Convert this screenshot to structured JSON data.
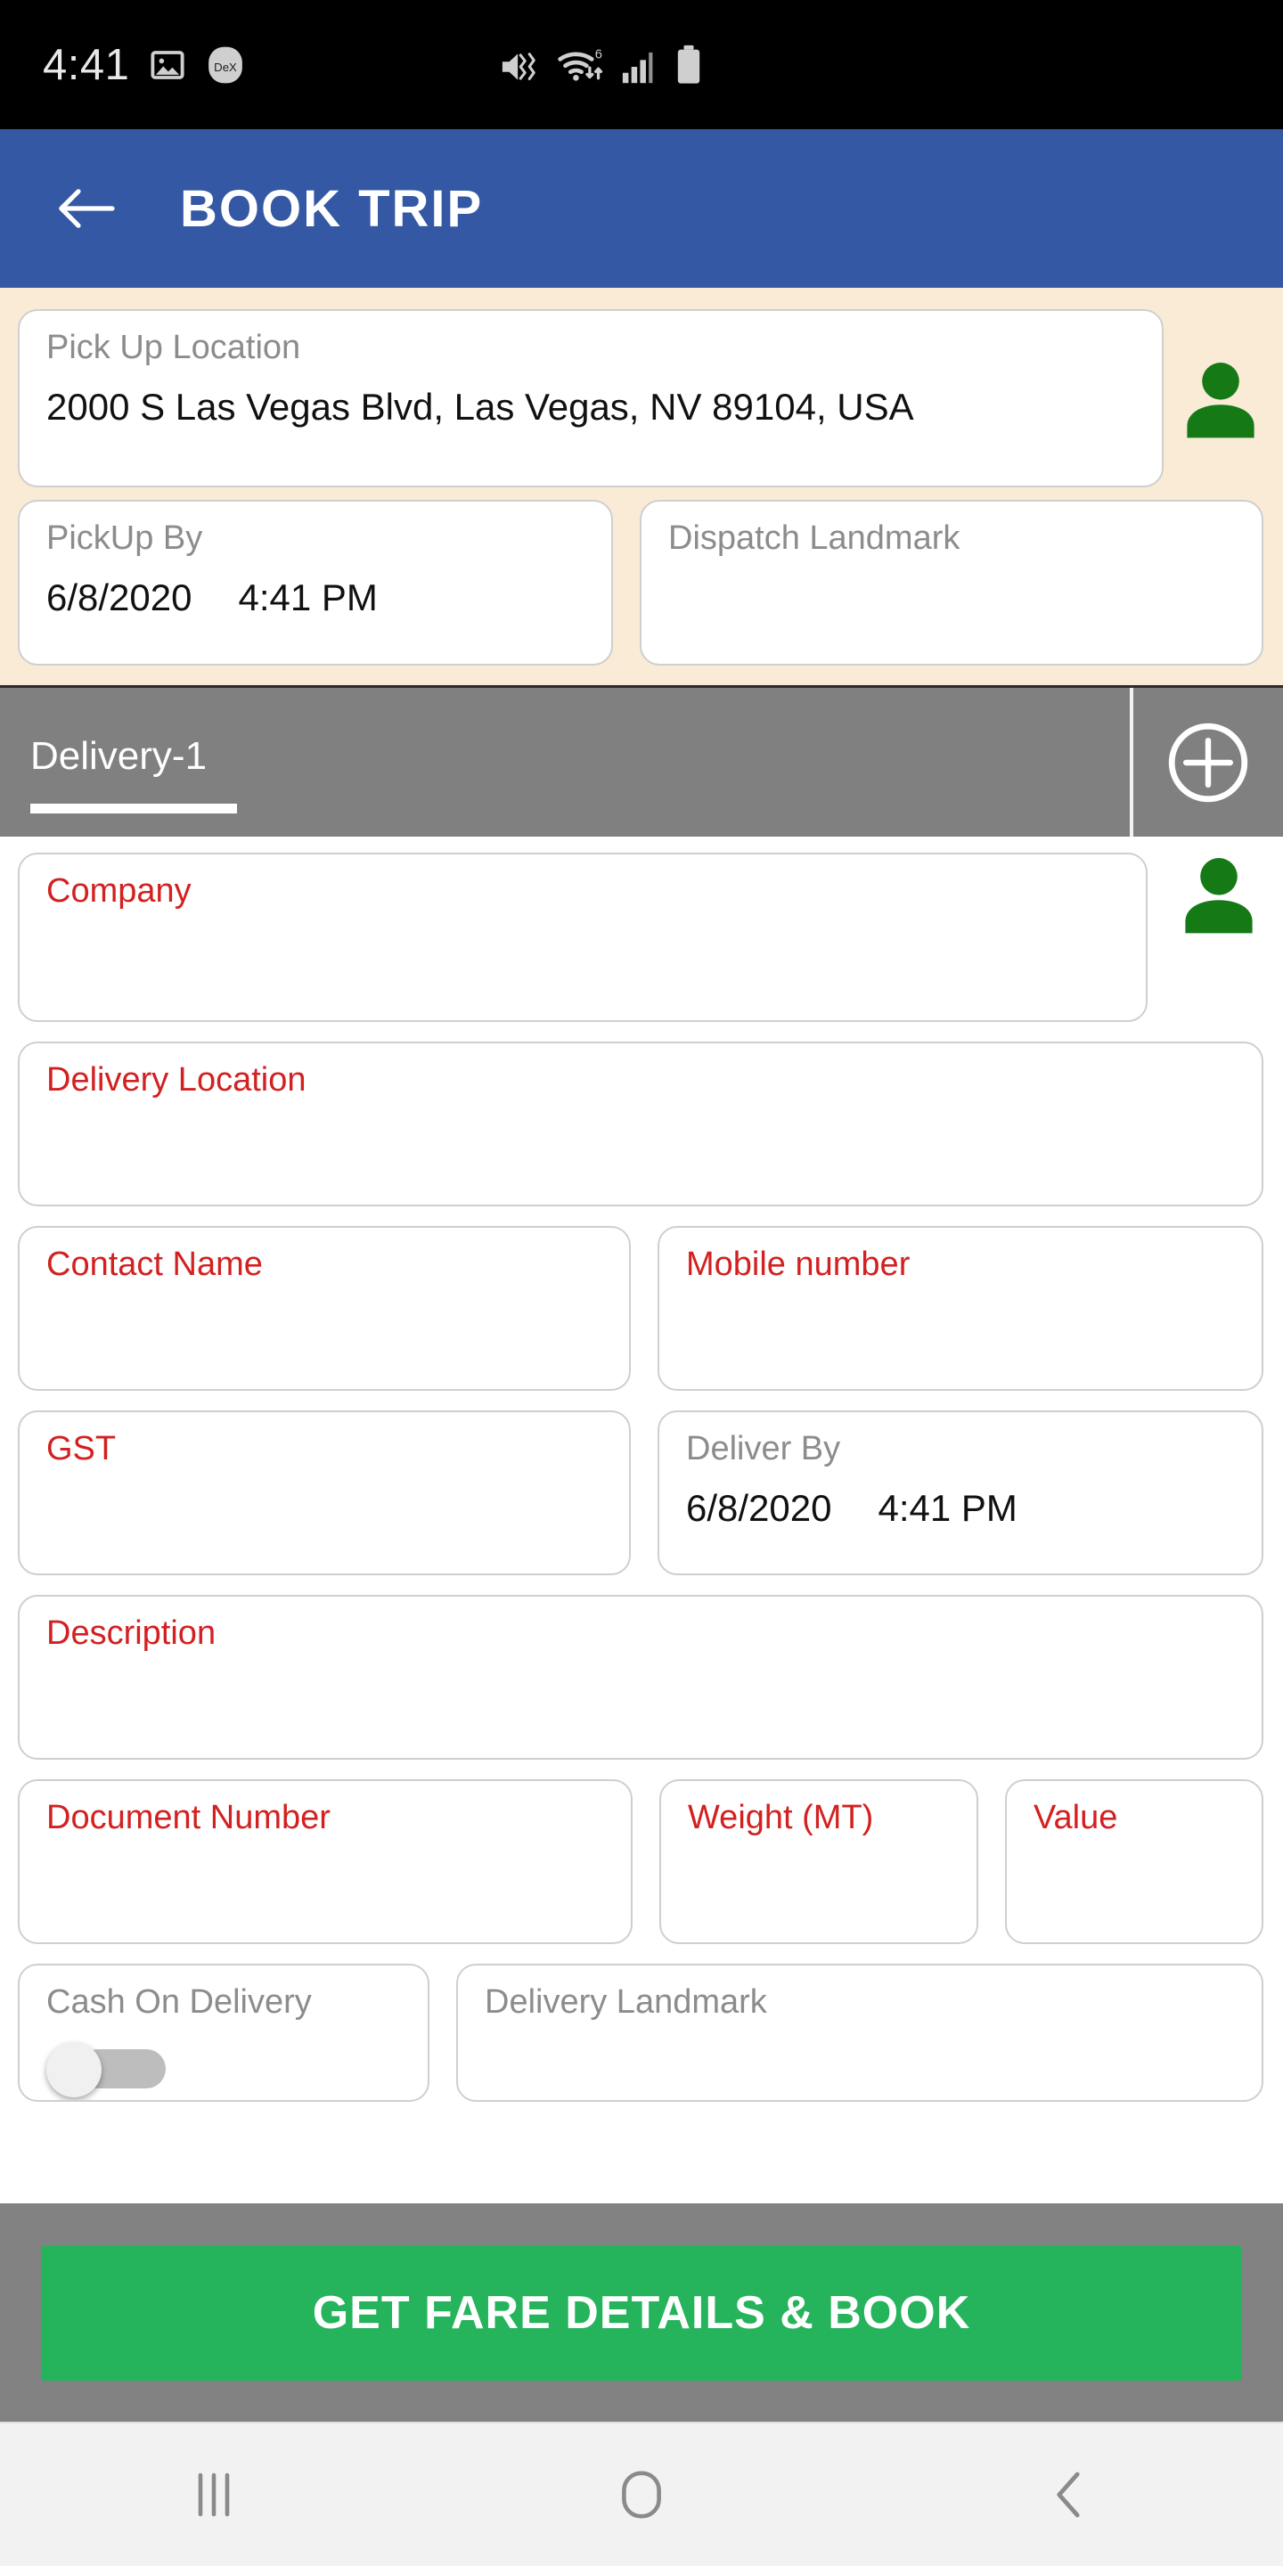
{
  "status_bar": {
    "time": "4:41",
    "icons_left": [
      "photo-icon",
      "dex-badge-icon"
    ],
    "dex_label": "DeX",
    "icons_right": [
      "mute-vibrate-icon",
      "wifi-6-icon",
      "signal-bars-icon",
      "battery-icon"
    ]
  },
  "app_bar": {
    "back_icon": "back-arrow-icon",
    "title": "BOOK TRIP",
    "background_color": "#3458A4"
  },
  "pickup": {
    "background_color": "#FAEBD7",
    "pickup_location": {
      "label": "Pick Up Location",
      "value": "2000 S Las Vegas Blvd, Las Vegas, NV 89104, USA",
      "label_color": "#8c8c8c"
    },
    "contact_picker_icon": "person-icon",
    "pickup_by": {
      "label": "PickUp By",
      "date": "6/8/2020",
      "time": "4:41 PM",
      "label_color": "#8c8c8c"
    },
    "dispatch_landmark": {
      "label": "Dispatch Landmark",
      "value": "",
      "label_color": "#8c8c8c"
    }
  },
  "tab_bar": {
    "background_color": "#808080",
    "tabs": [
      {
        "label": "Delivery-1",
        "active": true
      }
    ],
    "add_tab_icon": "plus-circle-icon"
  },
  "delivery_form": {
    "required_label_color": "#D32020",
    "optional_label_color": "#8c8c8c",
    "fields": [
      {
        "name": "company",
        "label": "Company",
        "value": "",
        "required": true
      },
      {
        "name": "delivery-location",
        "label": "Delivery Location",
        "value": "",
        "required": true
      },
      {
        "name": "contact-name",
        "label": "Contact Name",
        "value": "",
        "required": true
      },
      {
        "name": "mobile-number",
        "label": "Mobile number",
        "value": "",
        "required": true
      },
      {
        "name": "gst",
        "label": "GST",
        "value": "",
        "required": true
      },
      {
        "name": "description",
        "label": "Description",
        "value": "",
        "required": true
      },
      {
        "name": "document-number",
        "label": "Document Number",
        "value": "",
        "required": true
      },
      {
        "name": "weight",
        "label": "Weight (MT)",
        "value": "",
        "required": true
      },
      {
        "name": "value",
        "label": "Value",
        "value": "",
        "required": true
      },
      {
        "name": "delivery-landmark",
        "label": "Delivery Landmark",
        "value": "",
        "required": false
      }
    ],
    "deliver_by": {
      "label": "Deliver By",
      "date": "6/8/2020",
      "time": "4:41 PM",
      "required": false
    },
    "cash_on_delivery": {
      "label": "Cash On Delivery",
      "enabled": false
    },
    "contact_picker_icon": "person-icon"
  },
  "footer": {
    "background_color": "#828282",
    "cta_label": "GET FARE DETAILS & BOOK",
    "cta_color": "#25B35C"
  },
  "nav_bar": {
    "recents_icon": "recents-icon",
    "home_icon": "home-icon",
    "back_icon": "back-chevron-icon"
  }
}
